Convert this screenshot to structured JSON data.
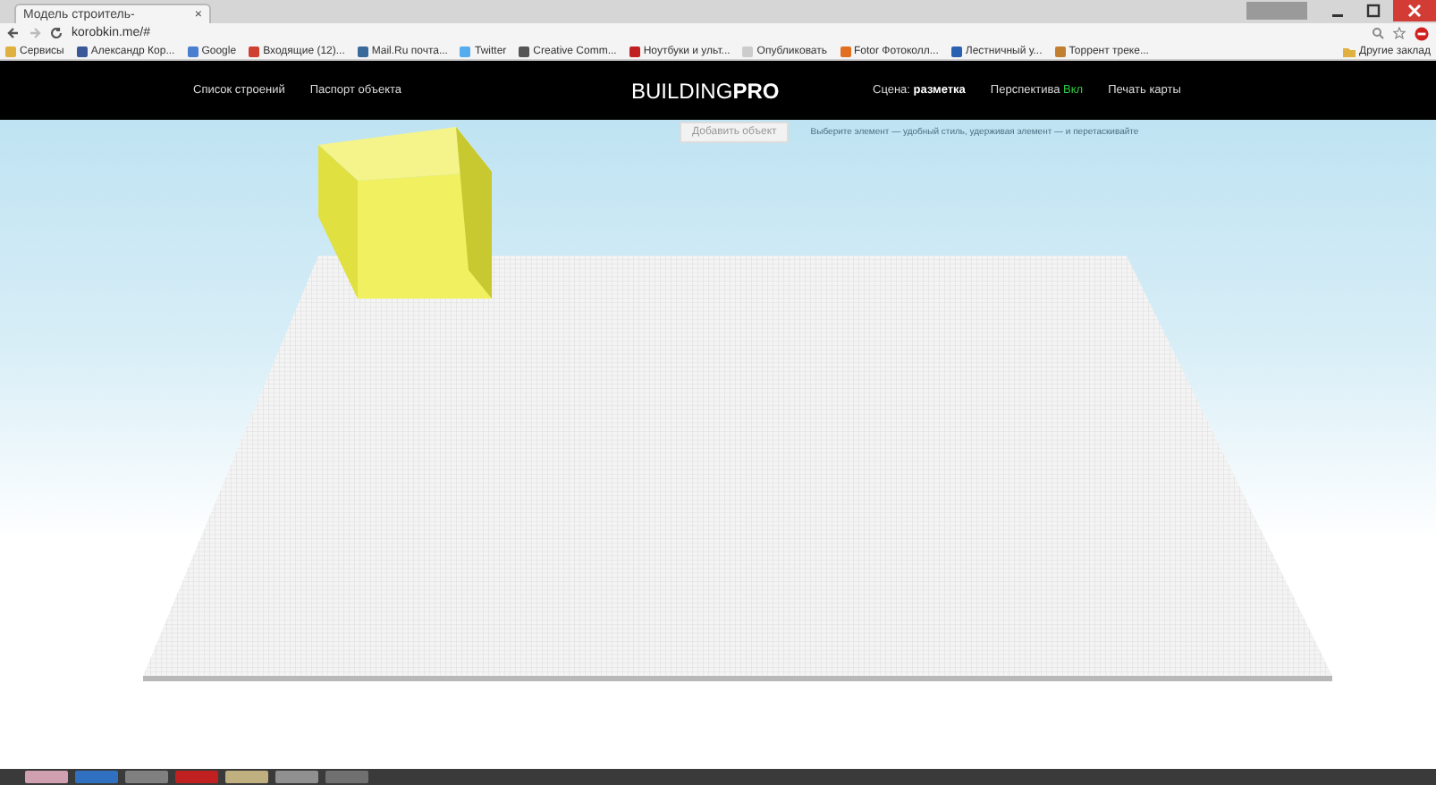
{
  "browser": {
    "tab": {
      "title": "Модель строитель-",
      "close": "×"
    },
    "address": "korobkin.me/#",
    "bookmarks": [
      {
        "label": "Сервисы",
        "color": "#e0b040"
      },
      {
        "label": "Александр Кор...",
        "color": "#3b5998"
      },
      {
        "label": "Google",
        "color": "#4a7fd0"
      },
      {
        "label": "Входящие (12)...",
        "color": "#d04030"
      },
      {
        "label": "Mail.Ru почта...",
        "color": "#3a6a9a"
      },
      {
        "label": "Twitter",
        "color": "#55acee"
      },
      {
        "label": "Creative Comm...",
        "color": "#555555"
      },
      {
        "label": "Ноутбуки и ульт...",
        "color": "#c02020"
      },
      {
        "label": "Опубликовать",
        "color": "#cccccc"
      },
      {
        "label": "Fotor Фотоколл...",
        "color": "#e07020"
      },
      {
        "label": "Лестничный у...",
        "color": "#2a60b0"
      },
      {
        "label": "Торрент треке...",
        "color": "#c08030"
      }
    ],
    "other_bookmarks": "Другие заклад"
  },
  "site": {
    "nav_left": [
      "Список строений",
      "Паспорт объекта"
    ],
    "brand": {
      "light": "BUILDING",
      "bold": "PRO"
    },
    "nav_right": [
      {
        "kind": "setting",
        "label": "Сцена:",
        "value": "разметка"
      },
      {
        "kind": "toggle",
        "label": "Перспектива",
        "value": "Вкл",
        "on": true
      },
      {
        "kind": "link",
        "label": "Печать карты"
      }
    ],
    "add_button": "Добавить объект",
    "hint": "Выберите элемент — удобный стиль, удерживая элемент — и перетаскивайте"
  },
  "taskbar": {
    "apps": [
      {
        "color": "#d0a0b0"
      },
      {
        "color": "#3070c0"
      },
      {
        "color": "#808080"
      },
      {
        "color": "#c02020"
      },
      {
        "color": "#c0b080"
      },
      {
        "color": "#909090"
      },
      {
        "color": "#707070"
      }
    ]
  }
}
